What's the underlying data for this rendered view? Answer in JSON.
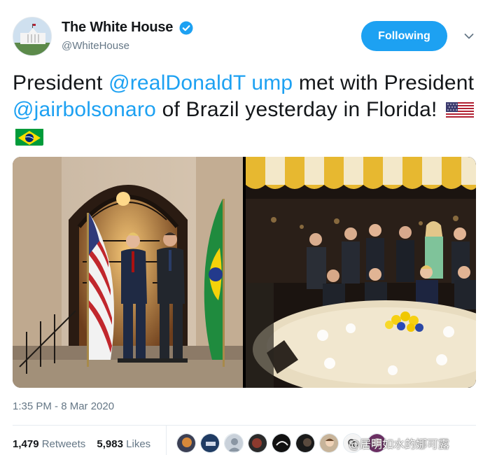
{
  "account": {
    "display_name": "The White House",
    "handle": "@WhiteHouse",
    "verified": true,
    "avatar_icon": "white-house-avatar"
  },
  "follow_button": {
    "label": "Following",
    "color": "#1da1f2"
  },
  "menu_icon": "chevron-down-icon",
  "tweet": {
    "part1": "President ",
    "mention1": "@realDonaldT ump",
    "part2": " met with President ",
    "mention2": "@jairbolsonaro",
    "part3": " of Brazil yesterday in Florida!",
    "emoji": [
      "us-flag-icon",
      "brazil-flag-icon"
    ],
    "mention_color": "#1da1f2"
  },
  "media": [
    {
      "name": "photo-two-presidents-with-flags"
    },
    {
      "name": "photo-dinner-table-group"
    }
  ],
  "timestamp": "1:35 PM - 8 Mar 2020",
  "stats": {
    "retweets_count": "1,479",
    "retweets_label": "Retweets",
    "likes_count": "5,983",
    "likes_label": "Likes"
  },
  "likers": [
    {
      "icon": "liker-avatar-1"
    },
    {
      "icon": "liker-avatar-2"
    },
    {
      "icon": "liker-avatar-3"
    },
    {
      "icon": "liker-avatar-4"
    },
    {
      "icon": "liker-avatar-5"
    },
    {
      "icon": "liker-avatar-6"
    },
    {
      "icon": "liker-avatar-7"
    },
    {
      "icon": "liker-avatar-8"
    },
    {
      "icon": "liker-avatar-9"
    }
  ],
  "watermark": "@居明如水的娜可露"
}
